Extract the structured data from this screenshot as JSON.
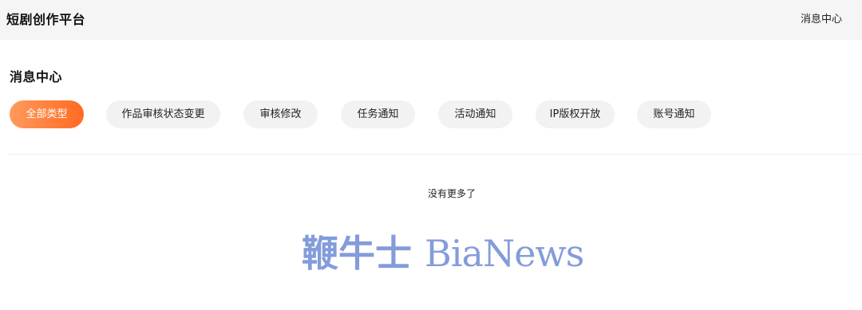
{
  "header": {
    "app_title": "短剧创作平台",
    "message_center_link": "消息中心"
  },
  "main": {
    "title": "消息中心",
    "tabs": [
      {
        "label": "全部类型",
        "active": true
      },
      {
        "label": "作品审核状态变更",
        "active": false
      },
      {
        "label": "审核修改",
        "active": false
      },
      {
        "label": "任务通知",
        "active": false
      },
      {
        "label": "活动通知",
        "active": false
      },
      {
        "label": "IP版权开放",
        "active": false
      },
      {
        "label": "账号通知",
        "active": false
      }
    ],
    "empty_text": "没有更多了"
  },
  "watermark": {
    "cn": "鞭牛士",
    "en": "BiaNews"
  },
  "colors": {
    "accent_start": "#ff9a5c",
    "accent_end": "#ff6a22",
    "header_bg": "#f5f5f5",
    "tab_bg": "#f2f2f2",
    "watermark": "#7e97d9"
  }
}
